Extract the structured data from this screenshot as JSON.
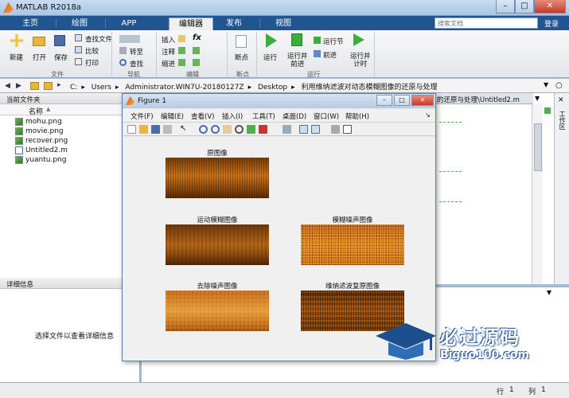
{
  "window": {
    "title": "MATLAB R2018a",
    "minimize": "–",
    "maximize": "□",
    "close": "✕"
  },
  "tabs": [
    {
      "label": "主页"
    },
    {
      "label": "绘图"
    },
    {
      "label": "APP"
    },
    {
      "label": "编辑器"
    },
    {
      "label": "发布"
    },
    {
      "label": "视图"
    }
  ],
  "search": {
    "placeholder": "搜索文档"
  },
  "login_label": "登录",
  "ribbon": {
    "file_group": {
      "label": "文件",
      "new": "新建",
      "open": "打开",
      "save": "保存",
      "find_files": "查找文件",
      "compare": "比较",
      "print": "打印"
    },
    "nav_group": {
      "label": "导航",
      "goto": "转至",
      "find": "查找"
    },
    "edit_group": {
      "label": "编辑",
      "insert": "插入",
      "comment": "注释",
      "indent": "缩进",
      "fx": "fx"
    },
    "breakpoint_group": {
      "label": "断点",
      "breakpoints": "断点"
    },
    "run_group": {
      "label": "运行",
      "run": "运行",
      "run_advance": "运行并\n前进",
      "run_section": "运行节",
      "advance": "前进",
      "run_time": "运行并\n计时"
    }
  },
  "address": {
    "path": [
      "C:",
      "Users",
      "Administrator.WIN7U-20180127Z",
      "Desktop",
      "利用维纳滤波对动态模糊图像的还原与处理"
    ]
  },
  "current_folder": {
    "title": "当前文件夹",
    "column_name": "名称",
    "sort_arrow": "▲",
    "files": [
      {
        "name": "mohu.png",
        "type": "png"
      },
      {
        "name": "movie.png",
        "type": "png"
      },
      {
        "name": "recover.png",
        "type": "png"
      },
      {
        "name": "Untitled2.m",
        "type": "m"
      },
      {
        "name": "yuantu.png",
        "type": "png"
      }
    ]
  },
  "details": {
    "title": "详细信息",
    "hint": "选择文件以查看详细信息"
  },
  "editor": {
    "tab_title": "的还原与处理\\Untitled2.m",
    "side_label": "工作区"
  },
  "figure": {
    "title": "Figure 1",
    "menu": [
      "文件(F)",
      "编辑(E)",
      "查看(V)",
      "插入(I)",
      "工具(T)",
      "桌面(D)",
      "窗口(W)",
      "帮助(H)"
    ],
    "subplots": [
      {
        "title": "原图像"
      },
      {
        "title": "运动模糊图像"
      },
      {
        "title": "模糊噪声图像"
      },
      {
        "title": "去除噪声图像"
      },
      {
        "title": "维纳滤波复原图像"
      }
    ]
  },
  "status": {
    "row_label": "行",
    "row": "1",
    "col_label": "列",
    "col": "1"
  },
  "watermark": {
    "brand": "必过源码",
    "domain": "Biguo100.com"
  },
  "colors": {
    "tabbar": "#1f5593",
    "accent": "#e4581c",
    "watermark": "#1d4f8e"
  }
}
